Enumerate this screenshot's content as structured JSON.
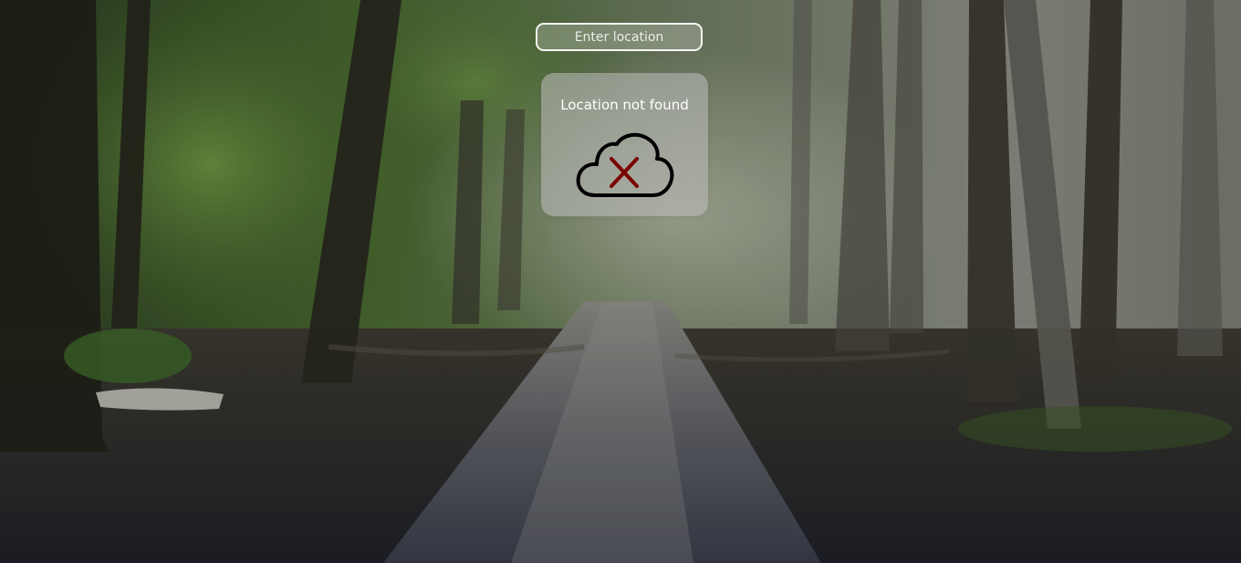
{
  "search": {
    "placeholder": "Enter location",
    "value": ""
  },
  "weather_card": {
    "status_text": "Location not found",
    "status_icon": "cloud-error-icon"
  },
  "background": {
    "icon": "forest-path-photo"
  },
  "colors": {
    "card_bg": "#bebebe",
    "icon_outline": "#000000",
    "icon_cross": "#7a0000",
    "text": "#ffffff"
  }
}
